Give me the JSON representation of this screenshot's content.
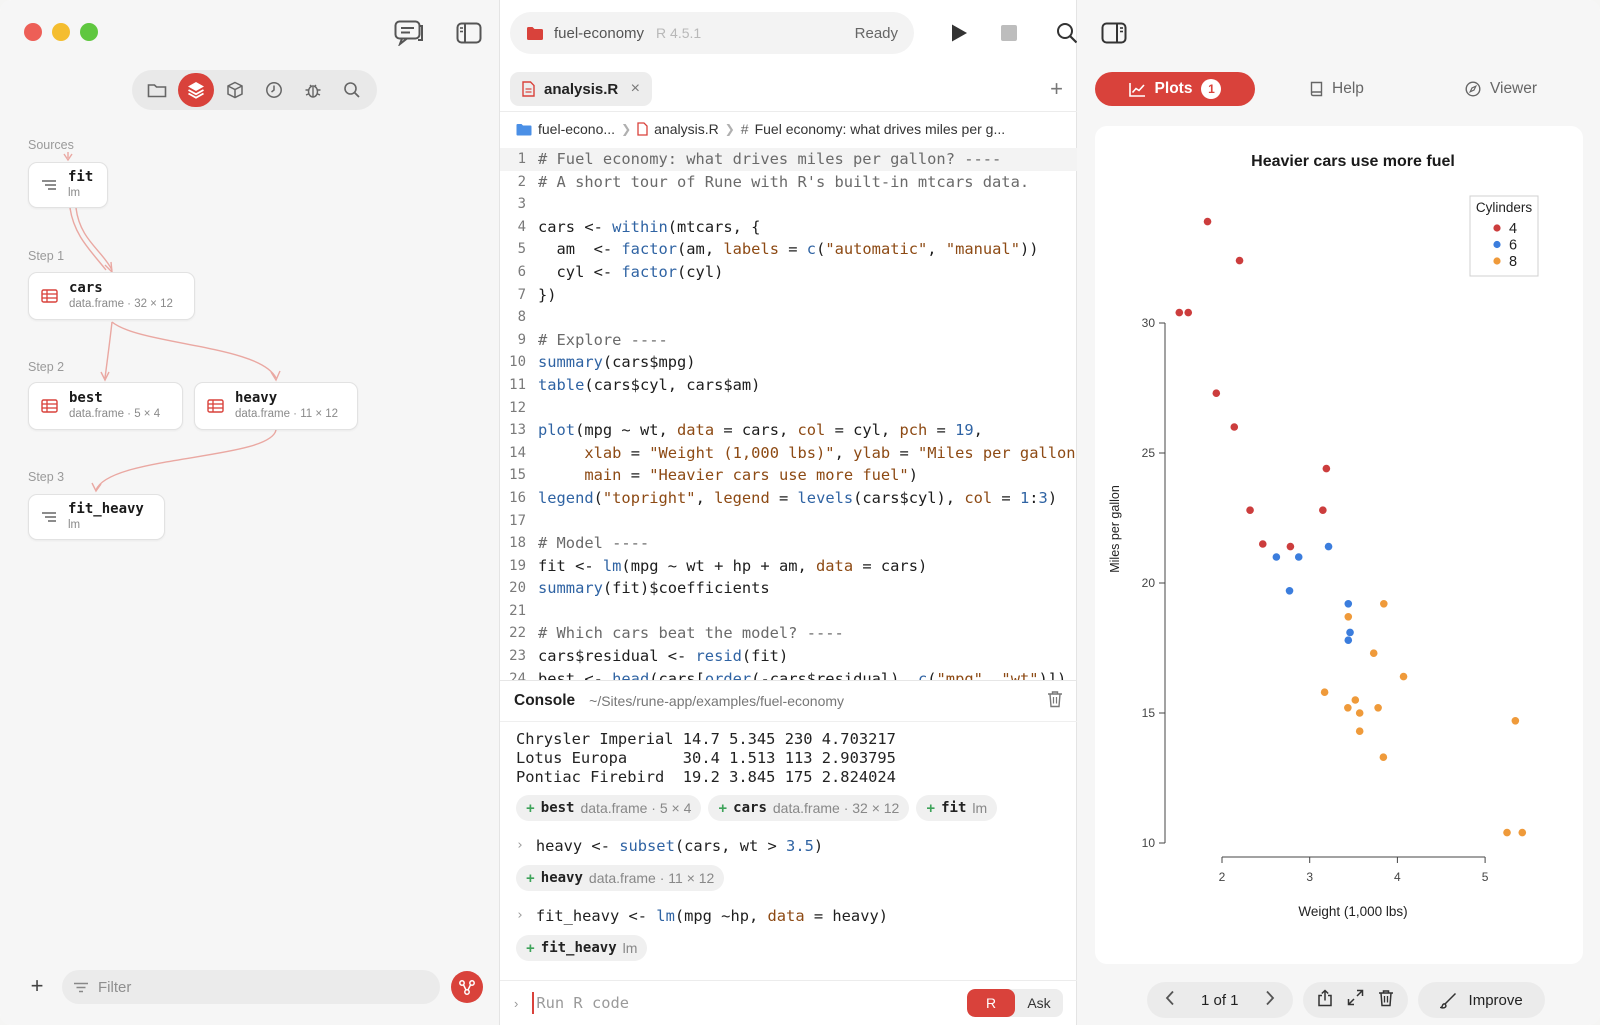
{
  "sidebar": {
    "labels": {
      "sources": "Sources",
      "step1": "Step 1",
      "step2": "Step 2",
      "step3": "Step 3"
    },
    "nodes": {
      "fit": {
        "name": "fit",
        "meta": "lm"
      },
      "cars": {
        "name": "cars",
        "meta": "data.frame · 32 × 12"
      },
      "best": {
        "name": "best",
        "meta": "data.frame · 5 × 4"
      },
      "heavy": {
        "name": "heavy",
        "meta": "data.frame · 11 × 12"
      },
      "fit_heavy": {
        "name": "fit_heavy",
        "meta": "lm"
      }
    },
    "filter_placeholder": "Filter",
    "add_label": "+"
  },
  "toolbar": {
    "project": "fuel-economy",
    "r_version": "R 4.5.1",
    "status": "Ready"
  },
  "editor": {
    "tab_label": "analysis.R",
    "tab_close": "×",
    "tab_add": "+",
    "breadcrumb": {
      "folder": "fuel-econo...",
      "file": "analysis.R",
      "section": "Fuel economy: what drives miles per g..."
    }
  },
  "console": {
    "title": "Console",
    "path": "~/Sites/rune-app/examples/fuel-economy",
    "output_lines": [
      "Chrysler Imperial 14.7 5.345 230 4.703217",
      "Lotus Europa      30.4 1.513 113 2.903795",
      "Pontiac Firebird  19.2 3.845 175 2.824024"
    ],
    "chips_1": [
      {
        "name": "best",
        "meta": "data.frame · 5 × 4"
      },
      {
        "name": "cars",
        "meta": "data.frame · 32 × 12"
      },
      {
        "name": "fit",
        "meta": "lm"
      }
    ],
    "cmd_2_prompt": "›",
    "chips_2": [
      {
        "name": "heavy",
        "meta": "data.frame · 11 × 12"
      }
    ],
    "chips_3": [
      {
        "name": "fit_heavy",
        "meta": "lm"
      }
    ],
    "input_placeholder": "Run R code",
    "mode_r": "R",
    "mode_ask": "Ask"
  },
  "panel": {
    "tabs": {
      "plots": "Plots",
      "plots_badge": "1",
      "help": "Help",
      "viewer": "Viewer"
    },
    "pager": "1 of 1",
    "improve": "Improve"
  },
  "colors": {
    "accent": "#d9423b",
    "cyl4": "#cc3d3d",
    "cyl6": "#3b7ddd",
    "cyl8": "#ef9a3a"
  },
  "chart_data": {
    "type": "scatter",
    "title": "Heavier cars use more fuel",
    "xlabel": "Weight (1,000 lbs)",
    "ylabel": "Miles per gallon",
    "xticks": [
      2,
      3,
      4,
      5
    ],
    "yticks": [
      10,
      15,
      20,
      25,
      30
    ],
    "legend": {
      "title": "Cylinders",
      "position": "top-right"
    },
    "series": [
      {
        "name": "4",
        "color": "#cc3d3d",
        "points": [
          [
            2.32,
            22.8
          ],
          [
            3.19,
            24.4
          ],
          [
            3.15,
            22.8
          ],
          [
            2.2,
            32.4
          ],
          [
            1.615,
            30.4
          ],
          [
            1.835,
            33.9
          ],
          [
            2.465,
            21.5
          ],
          [
            1.935,
            27.3
          ],
          [
            2.14,
            26.0
          ],
          [
            1.513,
            30.4
          ],
          [
            2.78,
            21.4
          ]
        ]
      },
      {
        "name": "6",
        "color": "#3b7ddd",
        "points": [
          [
            2.62,
            21.0
          ],
          [
            2.875,
            21.0
          ],
          [
            3.215,
            21.4
          ],
          [
            3.46,
            18.1
          ],
          [
            3.44,
            19.2
          ],
          [
            3.44,
            17.8
          ],
          [
            2.77,
            19.7
          ]
        ]
      },
      {
        "name": "8",
        "color": "#ef9a3a",
        "points": [
          [
            3.44,
            18.7
          ],
          [
            3.57,
            14.3
          ],
          [
            4.07,
            16.4
          ],
          [
            3.73,
            17.3
          ],
          [
            3.78,
            15.2
          ],
          [
            5.25,
            10.4
          ],
          [
            5.424,
            10.4
          ],
          [
            5.345,
            14.7
          ],
          [
            3.52,
            15.5
          ],
          [
            3.435,
            15.2
          ],
          [
            3.84,
            13.3
          ],
          [
            3.845,
            19.2
          ],
          [
            3.17,
            15.8
          ],
          [
            3.57,
            15.0
          ]
        ]
      }
    ]
  }
}
